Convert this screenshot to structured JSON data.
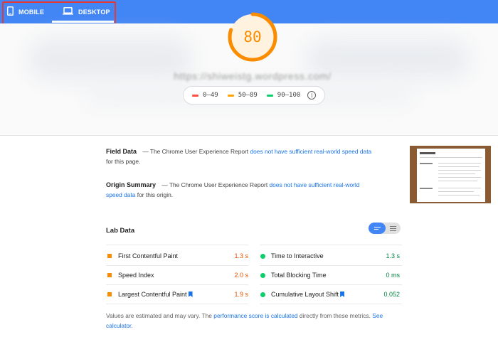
{
  "tabs": {
    "mobile_label": "MOBILE",
    "desktop_label": "DESKTOP",
    "active": "desktop"
  },
  "hero": {
    "score": "80",
    "score_fraction": 0.8,
    "url": "https://shiweistg.wordpress.com/",
    "legend": [
      {
        "label": "0–49",
        "color": "#ff4e42"
      },
      {
        "label": "50–89",
        "color": "#ffa400"
      },
      {
        "label": "90–100",
        "color": "#0cce6b"
      }
    ]
  },
  "field_data": {
    "heading": "Field Data",
    "text_before": "— The Chrome User Experience Report",
    "link": "does not have sufficient real-world speed data",
    "text_after": "for this page."
  },
  "origin_summary": {
    "heading": "Origin Summary",
    "text_before": "— The Chrome User Experience Report",
    "link": "does not have sufficient real-world speed data",
    "text_after": "for this origin."
  },
  "lab_data": {
    "heading": "Lab Data",
    "metrics_left": [
      {
        "label": "First Contentful Paint",
        "value": "1.3 s",
        "status": "average"
      },
      {
        "label": "Speed Index",
        "value": "2.0 s",
        "status": "average"
      },
      {
        "label": "Largest Contentful Paint",
        "value": "1.9 s",
        "status": "average"
      }
    ],
    "metrics_right": [
      {
        "label": "Time to Interactive",
        "value": "1.3 s",
        "status": "pass"
      },
      {
        "label": "Total Blocking Time",
        "value": "0 ms",
        "status": "pass"
      },
      {
        "label": "Cumulative Layout Shift",
        "value": "0.052",
        "status": "pass"
      }
    ]
  },
  "footnote": {
    "text_before": "Values are estimated and may vary. The",
    "link1": "performance score is calculated",
    "text_middle": "directly from these metrics.",
    "link2": "See calculator."
  },
  "colors": {
    "brand_blue": "#4285f4",
    "average_orange": "#fb8c00",
    "pass_green": "#0cce6b",
    "link_blue": "#1a73e8"
  }
}
